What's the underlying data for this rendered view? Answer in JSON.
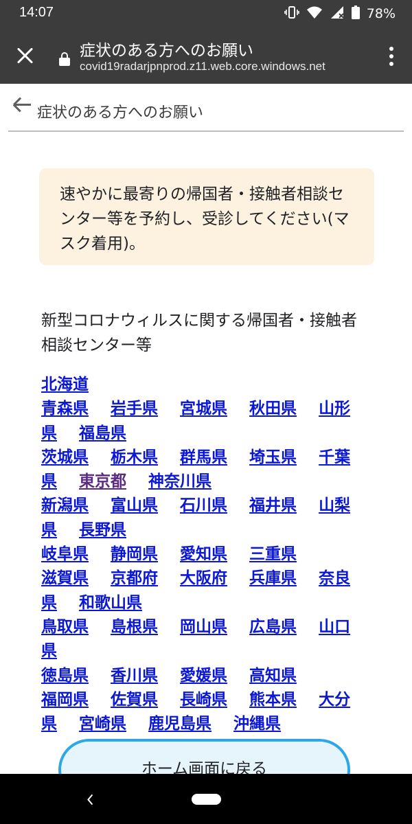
{
  "status_bar": {
    "time": "14:07",
    "battery": "78%",
    "icons": [
      "vibrate-icon",
      "wifi-icon",
      "signal-icon",
      "battery-icon"
    ]
  },
  "toolbar": {
    "title": "症状のある方へのお願い",
    "url": "covid19radarjpnprod.z11.web.core.windows.net"
  },
  "header": {
    "title": "症状のある方へのお願い"
  },
  "notice": {
    "text": "速やかに最寄りの帰国者・接触者相談センター等を予約し、受診してください(マスク着用)。"
  },
  "section": {
    "heading": "新型コロナウィルスに関する帰国者・接触者相談センター等"
  },
  "prefectures": [
    [
      "北海道"
    ],
    [
      "青森県",
      "岩手県",
      "宮城県",
      "秋田県",
      "山形県",
      "福島県"
    ],
    [
      "茨城県",
      "栃木県",
      "群馬県",
      "埼玉県",
      "千葉県",
      "東京都",
      "神奈川県"
    ],
    [
      "新潟県",
      "富山県",
      "石川県",
      "福井県",
      "山梨県",
      "長野県"
    ],
    [
      "岐阜県",
      "静岡県",
      "愛知県",
      "三重県"
    ],
    [
      "滋賀県",
      "京都府",
      "大阪府",
      "兵庫県",
      "奈良県",
      "和歌山県"
    ],
    [
      "鳥取県",
      "島根県",
      "岡山県",
      "広島県",
      "山口県"
    ],
    [
      "徳島県",
      "香川県",
      "愛媛県",
      "高知県"
    ],
    [
      "福岡県",
      "佐賀県",
      "長崎県",
      "熊本県",
      "大分県",
      "宮崎県",
      "鹿児島県",
      "沖縄県"
    ]
  ],
  "visited_prefecture": "東京都",
  "home_button": {
    "label": "ホーム画面に戻る"
  },
  "colors": {
    "link": "#0b17d6",
    "visited_link": "#5c2a86",
    "notice_bg": "#fdf1df",
    "button_border": "#2ea7e6",
    "toolbar_bg": "#3c3c3c"
  }
}
